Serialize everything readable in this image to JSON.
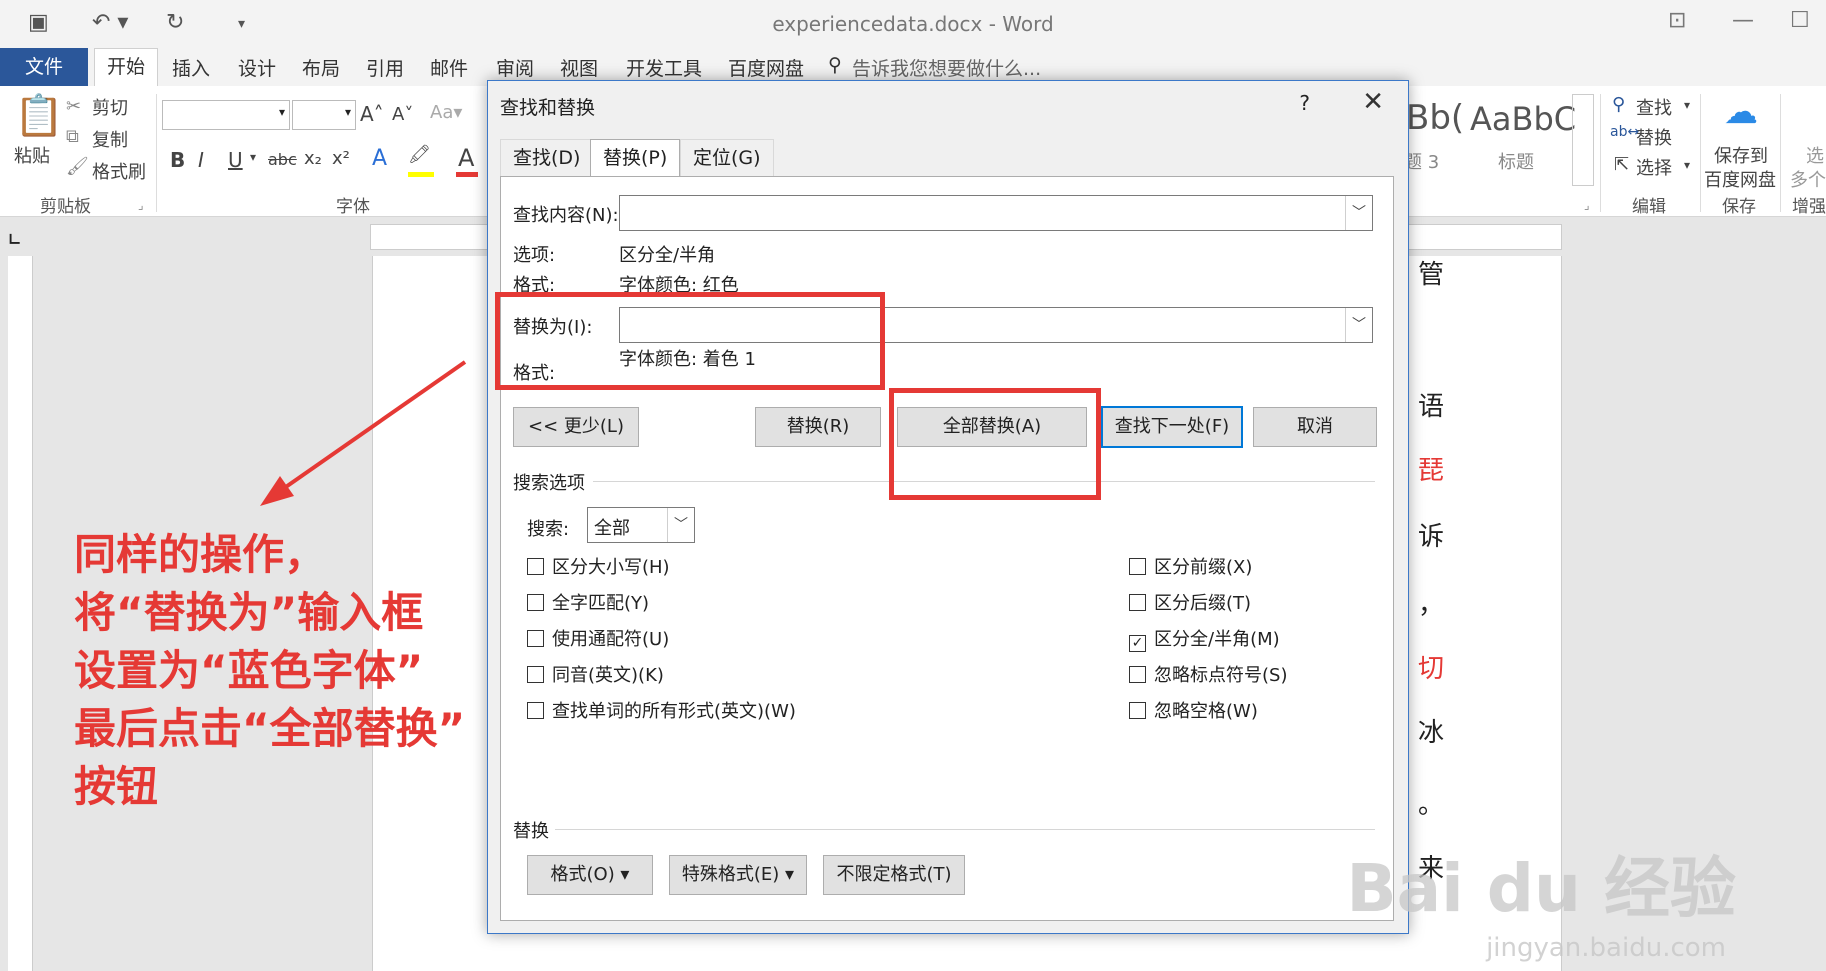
{
  "window": {
    "title": "experiencedata.docx - Word"
  },
  "menu": {
    "file": "文件",
    "tabs": [
      "开始",
      "插入",
      "设计",
      "布局",
      "引用",
      "邮件",
      "审阅",
      "视图",
      "开发工具",
      "百度网盘"
    ],
    "tell_me": "告诉我您想要做什么..."
  },
  "ribbon": {
    "paste": "粘贴",
    "cut": "剪切",
    "copy": "复制",
    "format_painter": "格式刷",
    "clipboard_group": "剪贴板",
    "font_group": "字体",
    "bold": "B",
    "italic": "I",
    "underline": "U",
    "strike": "abc",
    "style_heading3": "题 3",
    "style_title_preview": "AaBbC",
    "style_title": "标题",
    "style_bbc": "Bb(",
    "find": "查找",
    "replace": "替换",
    "select": "选择",
    "edit_group": "编辑",
    "save_to": "保存到",
    "baidu_pan": "百度网盘",
    "save_group": "保存",
    "more": "选",
    "more2": "多个",
    "enhance": "增强"
  },
  "doc": {
    "right_chars": [
      "管",
      "语",
      "琵",
      "诉",
      "，",
      "切",
      "冰",
      "。",
      "来"
    ]
  },
  "annotation": [
    "同样的操作，",
    "将“替换为”输入框",
    "设置为“蓝色字体”",
    "最后点击“全部替换”",
    "按钮"
  ],
  "dialog": {
    "title": "查找和替换",
    "help": "?",
    "tabs": [
      "查找(D)",
      "替换(P)",
      "定位(G)"
    ],
    "find_label": "查找内容(N):",
    "find_value": "",
    "options_label": "选项:",
    "options_value": "区分全/半角",
    "format_label": "格式:",
    "find_format": "字体颜色: 红色",
    "replace_label": "替换为(I):",
    "replace_value": "",
    "replace_format_label": "格式:",
    "replace_format": "字体颜色: 着色 1",
    "buttons": {
      "less": "<< 更少(L)",
      "replace": "替换(R)",
      "replace_all": "全部替换(A)",
      "find_next": "查找下一处(F)",
      "cancel": "取消"
    },
    "search_options": "搜索选项",
    "search_label": "搜索:",
    "search_value": "全部",
    "left_options": [
      "区分大小写(H)",
      "全字匹配(Y)",
      "使用通配符(U)",
      "同音(英文)(K)",
      "查找单词的所有形式(英文)(W)"
    ],
    "right_options": [
      {
        "label": "区分前缀(X)",
        "checked": false
      },
      {
        "label": "区分后缀(T)",
        "checked": false
      },
      {
        "label": "区分全/半角(M)",
        "checked": true
      },
      {
        "label": "忽略标点符号(S)",
        "checked": false
      },
      {
        "label": "忽略空格(W)",
        "checked": false
      }
    ],
    "replace_section": "替换",
    "format_btn": "格式(O) ▾",
    "special_btn": "特殊格式(E) ▾",
    "no_format_btn": "不限定格式(T)"
  },
  "watermark": {
    "logo": "Bai du 经验",
    "url": "jingyan.baidu.com"
  }
}
